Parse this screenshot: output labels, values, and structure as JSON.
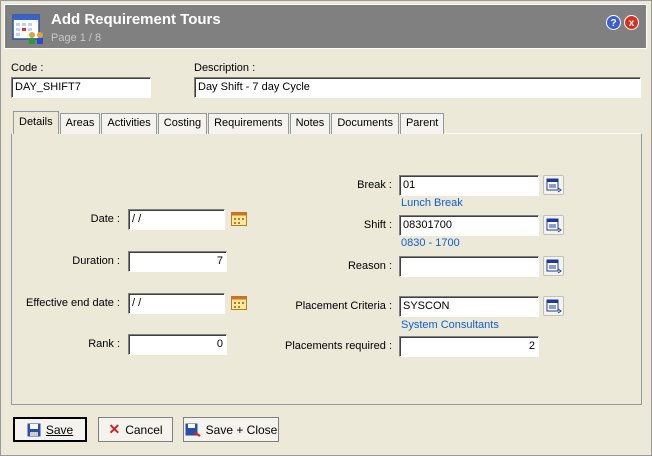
{
  "window": {
    "title": "Add Requirement Tours",
    "page": "Page 1 / 8",
    "help": "?",
    "close": "x"
  },
  "header": {
    "code_label": "Code :",
    "code_value": "DAY_SHIFT7",
    "description_label": "Description :",
    "description_value": "Day Shift - 7 day Cycle"
  },
  "tabs": [
    "Details",
    "Areas",
    "Activities",
    "Costing",
    "Requirements",
    "Notes",
    "Documents",
    "Parent"
  ],
  "details": {
    "date_label": "Date :",
    "date_value": " / /",
    "duration_label": "Duration :",
    "duration_value": "7",
    "end_label": "Effective end date :",
    "end_value": " / /",
    "rank_label": "Rank :",
    "rank_value": "0",
    "break_label": "Break :",
    "break_value": "01",
    "break_desc": "Lunch Break",
    "shift_label": "Shift :",
    "shift_value": "08301700",
    "shift_desc_start": "0830",
    "shift_desc_sep": " - ",
    "shift_desc_end": "1700",
    "reason_label": "Reason :",
    "reason_value": "",
    "criteria_label": "Placement Criteria :",
    "criteria_value": "SYSCON",
    "criteria_desc": "System Consultants",
    "placements_label": "Placements required :",
    "placements_value": "2"
  },
  "buttons": {
    "save": "Save",
    "cancel": "Cancel",
    "save_close": "Save + Close"
  }
}
